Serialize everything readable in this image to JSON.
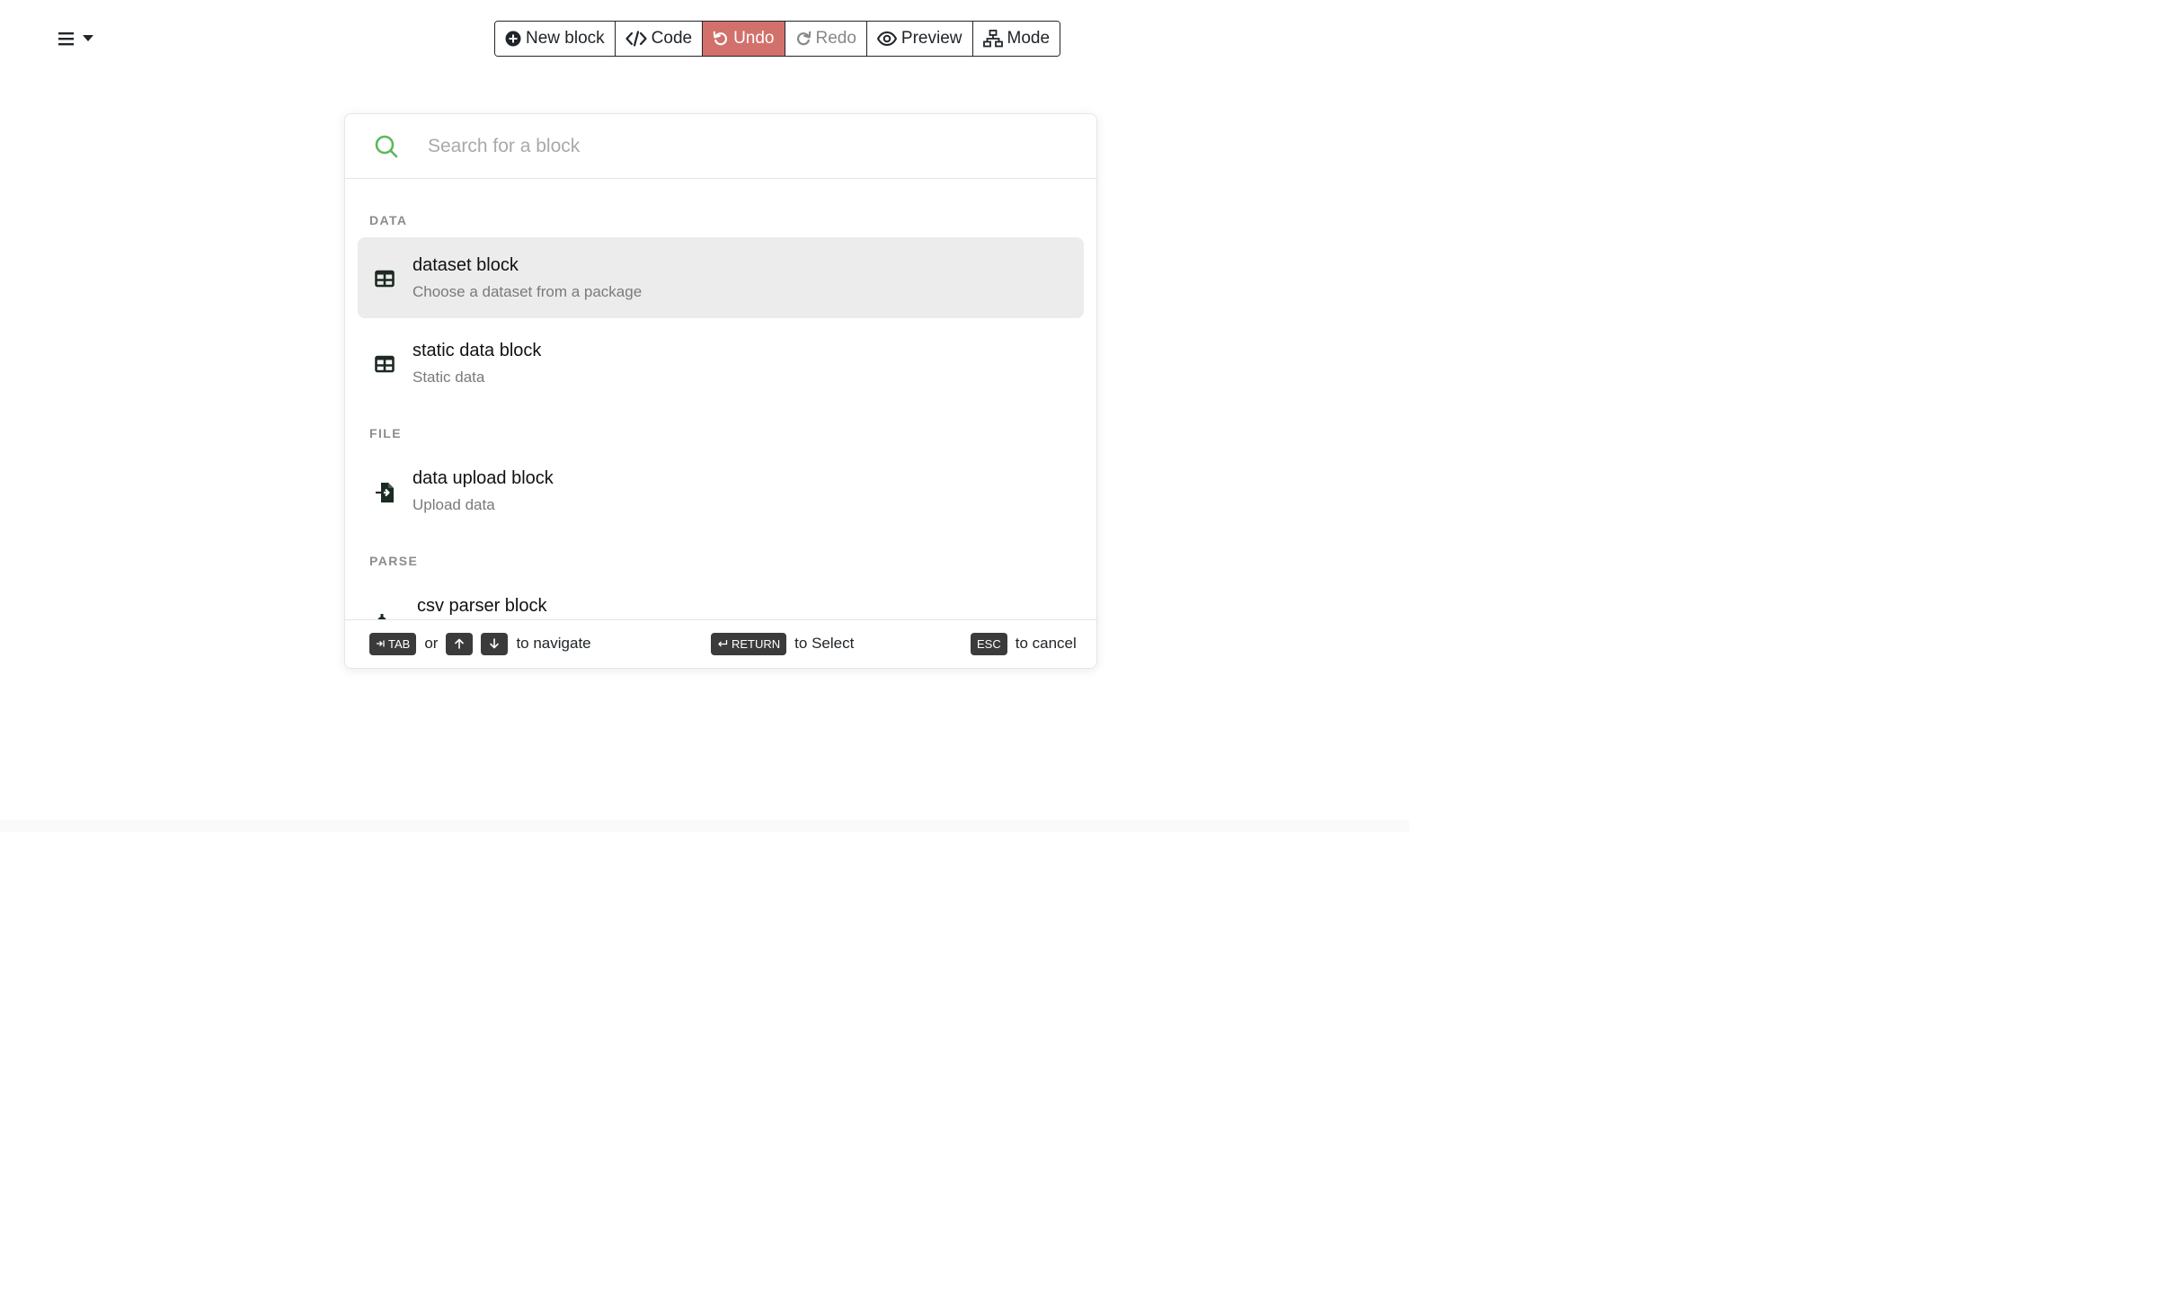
{
  "toolbar": {
    "new_block": "New block",
    "code": "Code",
    "undo": "Undo",
    "redo": "Redo",
    "preview": "Preview",
    "mode": "Mode"
  },
  "search": {
    "placeholder": "Search for a block",
    "value": ""
  },
  "groups": [
    {
      "label": "DATA",
      "items": [
        {
          "title": "dataset block",
          "description": "Choose a dataset from a package",
          "icon": "table-icon",
          "selected": true
        },
        {
          "title": "static data block",
          "description": "Static data",
          "icon": "table-icon",
          "selected": false
        }
      ]
    },
    {
      "label": "FILE",
      "items": [
        {
          "title": "data upload block",
          "description": "Upload data",
          "icon": "file-import-icon",
          "selected": false
        }
      ]
    },
    {
      "label": "PARSE",
      "items": [
        {
          "title": "csv parser block",
          "description": "",
          "icon": "gears-icon",
          "selected": false
        }
      ]
    }
  ],
  "footer": {
    "tab_key": "TAB",
    "or": "or",
    "navigate": "to navigate",
    "return_key": "RETURN",
    "select": "to Select",
    "esc_key": "ESC",
    "cancel": "to cancel"
  },
  "colors": {
    "undo_bg": "#d2706b",
    "search_icon": "#5cb85c",
    "selected_row": "#ececec",
    "kbd_bg": "#3b3b3b"
  }
}
